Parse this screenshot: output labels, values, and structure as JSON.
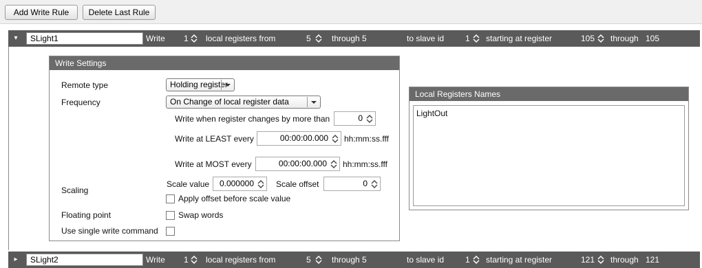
{
  "toolbar": {
    "add_label": "Add Write Rule",
    "delete_label": "Delete Last Rule"
  },
  "rules": [
    {
      "name": "SLight1",
      "write_label": "Write",
      "count": "1",
      "local_label": "local registers from",
      "from": "5",
      "through_label": "through 5",
      "slave_label": "to slave id",
      "slave_id": "1",
      "start_label": "starting at register",
      "start_register": "105",
      "through_end_label": "through",
      "end_register": "105",
      "expanded": true
    },
    {
      "name": "SLight2",
      "write_label": "Write",
      "count": "1",
      "local_label": "local registers from",
      "from": "5",
      "through_label": "through 5",
      "slave_label": "to slave id",
      "slave_id": "1",
      "start_label": "starting at register",
      "start_register": "121",
      "through_end_label": "through",
      "end_register": "121",
      "expanded": false
    }
  ],
  "write_settings": {
    "title": "Write Settings",
    "remote_type_label": "Remote type",
    "remote_type_value": "Holding register",
    "frequency_label": "Frequency",
    "frequency_value": "On Change of local register data",
    "change_label": "Write when register changes by more than",
    "change_value": "0",
    "least_label": "Write at LEAST every",
    "least_value": "00:00:00.000",
    "least_unit": "hh:mm:ss.fff",
    "most_label": "Write at MOST every",
    "most_value": "00:00:00.000",
    "most_unit": "hh:mm:ss.fff",
    "scaling_label": "Scaling",
    "scale_value_label": "Scale value",
    "scale_value": "0.000000",
    "scale_offset_label": "Scale offset",
    "scale_offset": "0",
    "apply_offset_label": "Apply offset before scale value",
    "floating_label": "Floating point",
    "swap_words_label": "Swap words",
    "single_write_label": "Use single write command"
  },
  "local_registers": {
    "title": "Local Registers Names",
    "items": [
      "LightOut"
    ]
  }
}
